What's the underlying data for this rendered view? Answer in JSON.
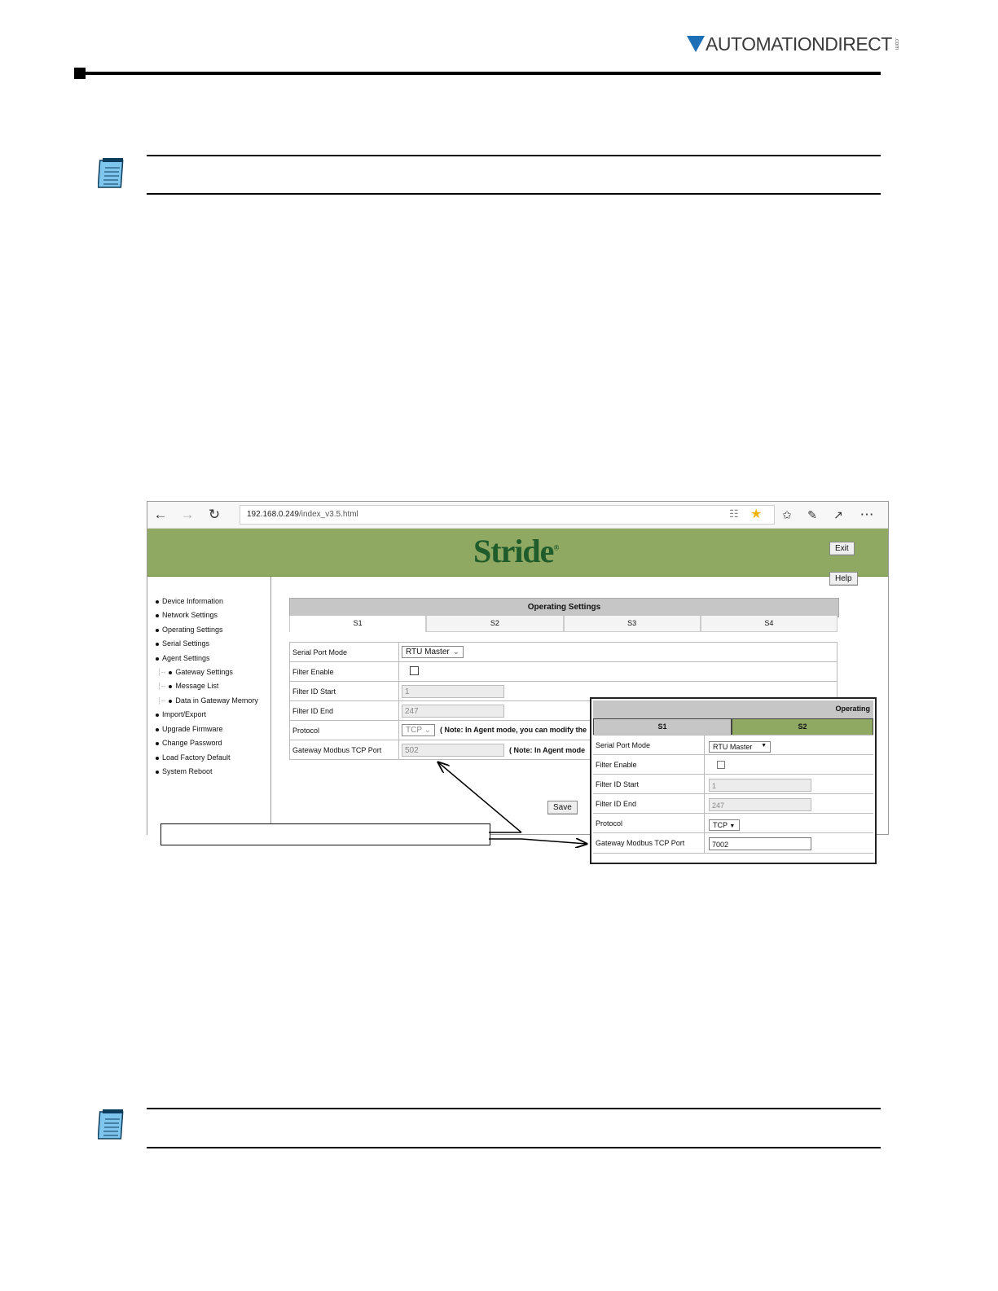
{
  "page": {
    "brand": {
      "name": "AUTOMATIONDIRECT",
      "suffix": ".com"
    }
  },
  "browser": {
    "url_host": "192.168.0.249",
    "url_path": "/index_v3.5.html",
    "icons": [
      "back-arrow-icon",
      "forward-arrow-icon",
      "refresh-icon",
      "reading-view-icon",
      "favorite-star-icon",
      "favorites-list-icon",
      "pen-icon",
      "share-icon",
      "more-icon"
    ]
  },
  "app": {
    "logo": "Stride",
    "logo_mark": "®",
    "exit_label": "Exit",
    "help_label": "Help",
    "save_label": "Save",
    "menu": [
      {
        "label": "Device Information"
      },
      {
        "label": "Network Settings"
      },
      {
        "label": "Operating Settings"
      },
      {
        "label": "Serial Settings"
      },
      {
        "label": "Agent Settings"
      },
      {
        "label": "Gateway Settings",
        "sub": true
      },
      {
        "label": "Message List",
        "sub": true
      },
      {
        "label": "Data in Gateway Memory",
        "sub": true
      },
      {
        "label": "Import/Export"
      },
      {
        "label": "Upgrade Firmware"
      },
      {
        "label": "Change Password"
      },
      {
        "label": "Load Factory Default"
      },
      {
        "label": "System Reboot"
      }
    ],
    "panel_title": "Operating Settings",
    "tabs": [
      {
        "label": "S1",
        "active": true
      },
      {
        "label": "S2"
      },
      {
        "label": "S3"
      },
      {
        "label": "S4"
      }
    ],
    "form": {
      "serial_port_mode": {
        "label": "Serial Port Mode",
        "value": "RTU Master"
      },
      "filter_enable": {
        "label": "Filter Enable",
        "checked": false
      },
      "filter_id_start": {
        "label": "Filter ID Start",
        "value": "1"
      },
      "filter_id_end": {
        "label": "Filter ID End",
        "value": "247"
      },
      "protocol": {
        "label": "Protocol",
        "value": "TCP",
        "note": "( Note: In Agent mode, you can modify the"
      },
      "gateway_port": {
        "label": "Gateway Modbus TCP Port",
        "value": "502",
        "note": "( Note: In Agent mode"
      }
    }
  },
  "inset": {
    "title": "Operating",
    "tabs": [
      {
        "label": "S1"
      },
      {
        "label": "S2",
        "active": true
      }
    ],
    "rows": {
      "serial_port_mode": {
        "label": "Serial Port Mode",
        "value": "RTU Master"
      },
      "filter_enable": {
        "label": "Filter Enable"
      },
      "filter_id_start": {
        "label": "Filter ID Start",
        "value": "1"
      },
      "filter_id_end": {
        "label": "Filter ID End",
        "value": "247"
      },
      "protocol": {
        "label": "Protocol",
        "value": "TCP"
      },
      "gateway_port": {
        "label": "Gateway Modbus TCP Port",
        "value": "7002"
      }
    }
  },
  "colors": {
    "banner": "#8fa862",
    "active_tab": "#8fa862",
    "brand_blue": "#1d6fb8"
  }
}
